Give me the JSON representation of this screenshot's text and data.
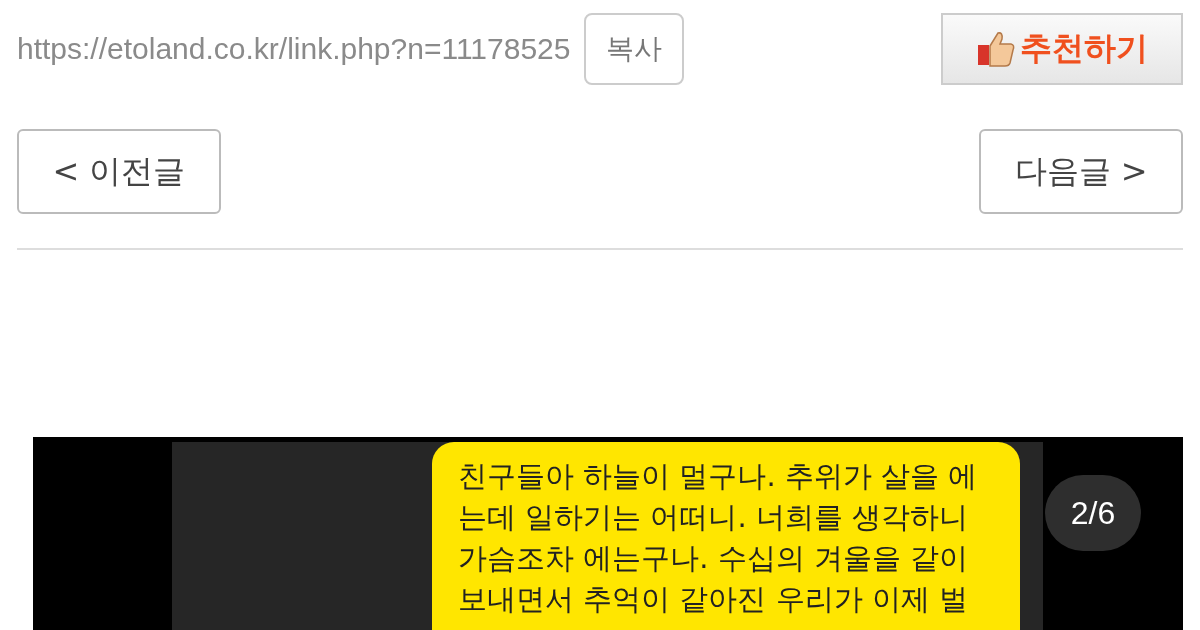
{
  "link_bar": {
    "url": "https://etoland.co.kr/link.php?n=11178525",
    "copy_button": "복사",
    "recommend_button": "추천하기"
  },
  "navigation": {
    "previous": {
      "arrow": "<",
      "label": "이전글"
    },
    "next": {
      "label": "다음글",
      "arrow": ">"
    }
  },
  "post_image": {
    "message_lines": [
      "친구들아 하늘이 멀구나. 추위가 살을 에",
      "는데 일하기는 어떠니. 너희를 생각하니",
      "가슴조차 에는구나. 수십의 겨울을 같이",
      "보내면서 추억이 같아진 우리가 이제 벌"
    ],
    "page_counter": "2/6"
  }
}
